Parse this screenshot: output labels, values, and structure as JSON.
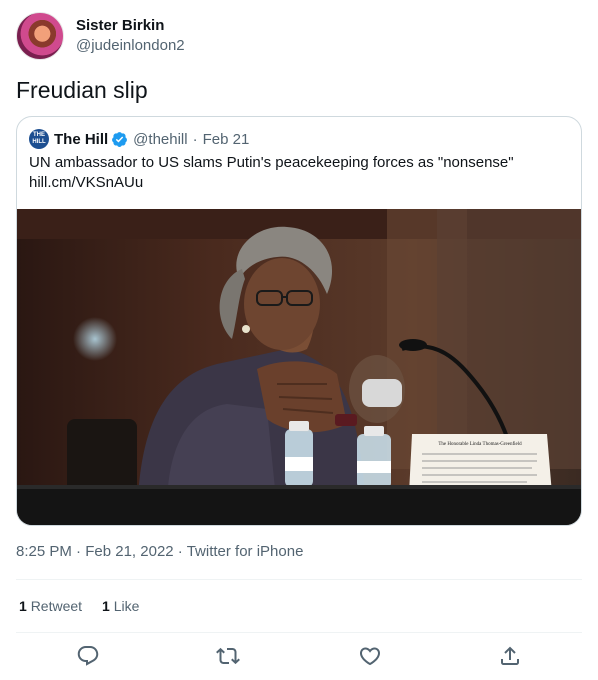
{
  "author": {
    "display_name": "Sister Birkin",
    "handle": "@judeinlondon2"
  },
  "tweet": {
    "text": "Freudian slip",
    "time": "8:25 PM",
    "date": "Feb 21, 2022",
    "source": "Twitter for iPhone",
    "separator": "·"
  },
  "quoted": {
    "avatar_text": "THE HILL",
    "name": "The Hill",
    "handle": "@thehill",
    "date": "Feb 21",
    "separator": "·",
    "text": "UN ambassador to US slams Putin's peacekeeping forces as \"nonsense\"",
    "link": "hill.cm/VKSnAUu",
    "placard_text": "The Honorable Linda Thomas-Greenfield"
  },
  "stats": {
    "retweets_count": "1",
    "retweets_label": "Retweet",
    "likes_count": "1",
    "likes_label": "Like"
  },
  "actions": [
    "reply-icon",
    "retweet-icon",
    "like-icon",
    "share-icon"
  ],
  "colors": {
    "text": "#0f1419",
    "secondary": "#536471",
    "border": "#cfd9de",
    "verified": "#1d9bf0"
  }
}
